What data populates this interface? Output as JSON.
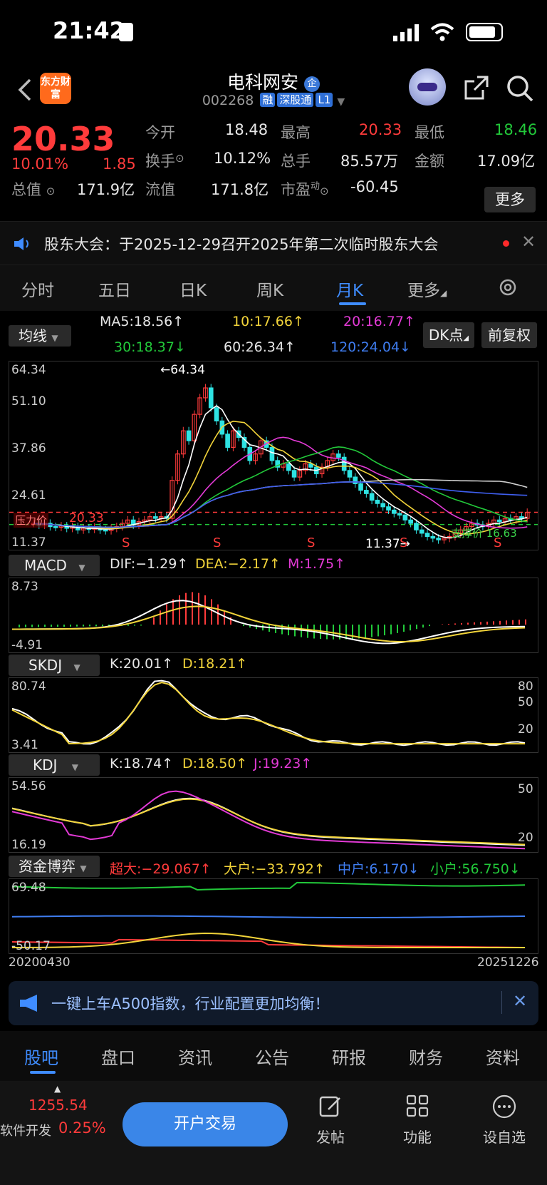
{
  "status": {
    "time": "21:42"
  },
  "header": {
    "logo": "东方财富",
    "name": "电科网安",
    "name_badge": "企",
    "code": "002268",
    "tags": [
      "融",
      "深股通",
      "L1"
    ]
  },
  "quote": {
    "price": "20.33",
    "change_pct": "10.01%",
    "change": "1.85",
    "open_label": "今开",
    "open": "18.48",
    "high_label": "最高",
    "high": "20.33",
    "low_label": "最低",
    "low": "18.46",
    "turnover_label": "换手",
    "turnover": "10.12%",
    "volume_label": "总手",
    "volume": "85.57万",
    "amount_label": "金额",
    "amount": "17.09亿",
    "mcap_label": "总值",
    "mcap": "171.9亿",
    "float_label": "流值",
    "float": "171.8亿",
    "pe_label": "市盈",
    "pe_sup": "动",
    "pe": "-60.45",
    "more": "更多"
  },
  "notice": {
    "text": "股东大会：于2025-12-29召开2025年第二次临时股东大会"
  },
  "tabs": [
    "分时",
    "五日",
    "日K",
    "周K",
    "月K",
    "更多"
  ],
  "active_tab": "月K",
  "ma": {
    "selector": "均线",
    "ma5": "MA5:18.56↑",
    "ma10": "10:17.66↑",
    "ma20": "20:16.77↑",
    "ma30": "30:18.37↓",
    "ma60": "60:26.34↑",
    "ma120": "120:24.04↓",
    "dk": "DK点",
    "adjust": "前复权"
  },
  "kline": {
    "y_labels": [
      "64.34",
      "51.10",
      "37.86",
      "24.61",
      "11.37"
    ],
    "max_label": "←64.34",
    "min_label": "11.37→",
    "price_tag": "20.33",
    "support_tag": "支撑价 16.63",
    "resist_tag": "压力价",
    "s_marks": [
      "S",
      "S",
      "S",
      "S",
      "S"
    ]
  },
  "macd": {
    "selector": "MACD",
    "dif": "DIF:−1.29↑",
    "dea": "DEA:−2.17↑",
    "m": "M:1.75↑",
    "y_top": "8.73",
    "y_bot": "-4.91"
  },
  "skdj": {
    "selector": "SKDJ",
    "k": "K:20.01↑",
    "d": "D:18.21↑",
    "y_top": "80.74",
    "y_bot": "3.41",
    "r1": "80",
    "r2": "50",
    "r3": "20"
  },
  "kdj": {
    "selector": "KDJ",
    "k": "K:18.74↑",
    "d": "D:18.50↑",
    "j": "J:19.23↑",
    "y_top": "54.56",
    "y_bot": "16.19",
    "r1": "50",
    "r2": "20"
  },
  "fund": {
    "selector": "资金博弈",
    "super": "超大:−29.067↑",
    "big": "大户:−33.792↑",
    "mid": "中户:6.170↓",
    "small": "小户:56.750↓",
    "y_top": "69.48",
    "y_bot": "-50.17",
    "date_start": "20200430",
    "date_end": "20251226"
  },
  "ad": {
    "text": "一键上车A500指数，行业配置更加均衡！"
  },
  "bottom_tabs": [
    "股吧",
    "盘口",
    "资讯",
    "公告",
    "研报",
    "财务",
    "资料"
  ],
  "footer": {
    "index_value": "1255.54",
    "index_name": "软件开发",
    "index_pct": "0.25%",
    "trade": "开户交易",
    "post": "发帖",
    "func": "功能",
    "watch": "设自选"
  }
}
